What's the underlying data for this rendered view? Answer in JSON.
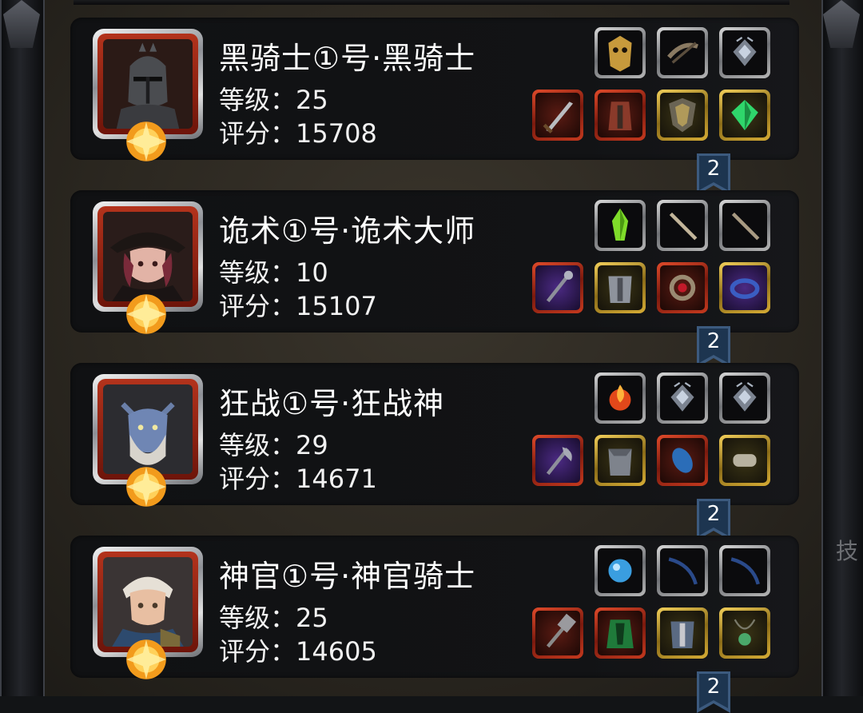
{
  "background_hint": "技",
  "heroes": [
    {
      "name": "黑骑士①号·黑骑士",
      "level_text": "等级：25",
      "score_text": "评分：15708",
      "portrait": "dark-knight-helmet",
      "skills": [
        "golden-mask-icon",
        "crossbow-icon",
        "rank-badge-icon"
      ],
      "equipment": [
        {
          "icon": "greatsword-icon",
          "rarity": "red"
        },
        {
          "icon": "red-armor-icon",
          "rarity": "red"
        },
        {
          "icon": "shield-icon",
          "rarity": "gold"
        },
        {
          "icon": "green-gem-icon",
          "rarity": "gold"
        }
      ],
      "ribbon_number": "2"
    },
    {
      "name": "诡术①号·诡术大师",
      "level_text": "等级：10",
      "score_text": "评分：15107",
      "portrait": "hooded-girl",
      "skills": [
        "green-crystal-icon",
        "dagger-icon",
        "blade-icon"
      ],
      "equipment": [
        {
          "icon": "scepter-icon",
          "rarity": "red"
        },
        {
          "icon": "chest-armor-icon",
          "rarity": "gold"
        },
        {
          "icon": "ruby-ring-icon",
          "rarity": "red"
        },
        {
          "icon": "sapphire-ring-icon",
          "rarity": "gold"
        }
      ],
      "ribbon_number": "2"
    },
    {
      "name": "狂战①号·狂战神",
      "level_text": "等级：29",
      "score_text": "评分：14671",
      "portrait": "blue-demon",
      "skills": [
        "fire-orb-icon",
        "rank-badge-icon",
        "rank-badge-icon"
      ],
      "equipment": [
        {
          "icon": "battle-axe-icon",
          "rarity": "red"
        },
        {
          "icon": "steel-armor-icon",
          "rarity": "gold"
        },
        {
          "icon": "blue-shield-icon",
          "rarity": "red"
        },
        {
          "icon": "bracer-icon",
          "rarity": "gold"
        }
      ],
      "ribbon_number": "2"
    },
    {
      "name": "神官①号·神官骑士",
      "level_text": "等级：25",
      "score_text": "评分：14605",
      "portrait": "white-haired-knight",
      "skills": [
        "blue-orb-icon",
        "bow-icon",
        "bow-icon"
      ],
      "equipment": [
        {
          "icon": "warhammer-icon",
          "rarity": "red"
        },
        {
          "icon": "green-robe-icon",
          "rarity": "red"
        },
        {
          "icon": "knight-armor-icon",
          "rarity": "gold"
        },
        {
          "icon": "amulet-icon",
          "rarity": "gold"
        }
      ],
      "ribbon_number": "2"
    }
  ]
}
